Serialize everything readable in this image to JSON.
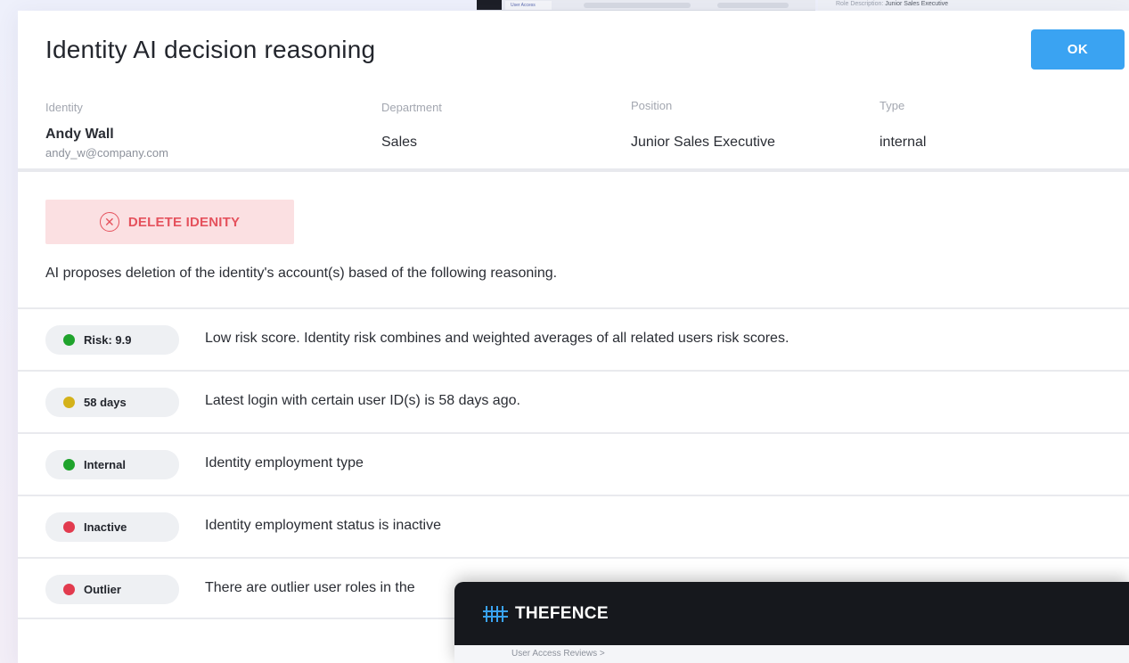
{
  "background": {
    "peek_tab": "User Access",
    "peek_right_label": "Role Description:",
    "peek_right_value": "Junior Sales Executive"
  },
  "dialog": {
    "title": "Identity AI decision reasoning",
    "ok_label": "OK"
  },
  "identity": {
    "identity_label": "Identity",
    "name": "Andy Wall",
    "email": "andy_w@company.com",
    "department_label": "Department",
    "department": "Sales",
    "position_label": "Position",
    "position": "Junior Sales Executive",
    "type_label": "Type",
    "type": "internal"
  },
  "action": {
    "label": "DELETE IDENITY",
    "icon": "x-circle-icon",
    "color": "#e5525d",
    "background": "#fbe0e2"
  },
  "ai_summary": "AI proposes deletion of the identity's account(s) based of the following reasoning.",
  "reasons": [
    {
      "badge": "Risk: 9.9",
      "status_color": "#1fa32c",
      "description": "Low risk score. Identity risk combines and weighted averages of all related users risk scores."
    },
    {
      "badge": "58 days",
      "status_color": "#d4b21a",
      "description": "Latest login with certain user ID(s) is 58 days ago."
    },
    {
      "badge": "Internal",
      "status_color": "#1fa32c",
      "description": "Identity employment type"
    },
    {
      "badge": "Inactive",
      "status_color": "#e23b4e",
      "description": "Identity employment status is inactive"
    },
    {
      "badge": "Outlier",
      "status_color": "#e23b4e",
      "description": "There are outlier user roles in the"
    }
  ],
  "overlay": {
    "brand": "THEFENCE",
    "brand_color": "#3aa3f2",
    "breadcrumb": "User Access Reviews  >"
  },
  "colors": {
    "accent": "#3aa3f2",
    "danger": "#e5525d"
  }
}
